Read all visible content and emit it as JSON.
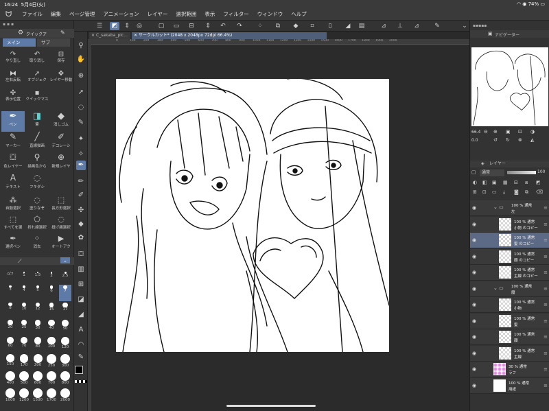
{
  "status": {
    "time": "16:24",
    "date": "5月4日(火)",
    "battery": "74%"
  },
  "menu": {
    "items": [
      "ファイル",
      "編集",
      "ページ管理",
      "アニメーション",
      "レイヤー",
      "選択範囲",
      "表示",
      "フィルター",
      "ウィンドウ",
      "ヘルプ"
    ]
  },
  "tabs": {
    "file1": "C_sakaba_pic...",
    "file2": "サークルカット* (2048 x 2048px 72dpi 66.4%)"
  },
  "ruler": [
    "0",
    "100",
    "200",
    "300",
    "400",
    "500",
    "600",
    "700",
    "800",
    "900",
    "1000",
    "1100",
    "1200",
    "1300",
    "1400",
    "1500",
    "1600",
    "1700",
    "1800",
    "1900",
    "2000"
  ],
  "tool_panel": {
    "header": "クイックア",
    "tab_main": "メイン",
    "tab_sub": "サブ",
    "tools": [
      "やり直し",
      "取り消し",
      "保存",
      "左右反転",
      "オブジェク",
      "レイヤー移動",
      "表示位置",
      "クイックマス",
      "ペン",
      "筆",
      "消しゴム",
      "マーカー",
      "直線描画",
      "デコレーシ",
      "色レイヤー",
      "描画色から",
      "新規レイヤ",
      "テキスト",
      "フキダシ",
      "自動選択",
      "塗りなぞ",
      "長方形選択",
      "すべてを選",
      "折れ線選択",
      "投げ縄選択",
      "選択ペン",
      "消去",
      "オートアク"
    ]
  },
  "brush_sizes": [
    "0.7",
    "1",
    "1.5",
    "2",
    "2.5",
    "3",
    "4",
    "5",
    "6",
    "7",
    "8",
    "10",
    "12",
    "15",
    "17",
    "20",
    "25",
    "30",
    "40",
    "50",
    "60",
    "70",
    "80",
    "100",
    "120",
    "150",
    "170",
    "200",
    "250",
    "300",
    "400",
    "500",
    "600",
    "700",
    "800",
    "1000",
    "1200",
    "1500",
    "1700",
    "2000"
  ],
  "brush_selected": "7",
  "navigator": {
    "title": "ナビゲーター"
  },
  "zoom_value": "66.4",
  "rotation_value": "0.0",
  "layer_panel": {
    "title": "レイヤー",
    "blend_mode": "通常",
    "opacity": "100",
    "layers": [
      {
        "line1": "100 % 通常",
        "line2": "左",
        "type": "folder",
        "selected": false
      },
      {
        "line1": "100 % 通常",
        "line2": "小物 のコピー",
        "type": "layer",
        "selected": false
      },
      {
        "line1": "100 % 通常",
        "line2": "髪 のコピー",
        "type": "layer",
        "selected": true
      },
      {
        "line1": "100 % 通常",
        "line2": "顔 のコピー",
        "type": "layer",
        "selected": false
      },
      {
        "line1": "100 % 通常",
        "line2": "主線 のコピー",
        "type": "layer",
        "selected": false
      },
      {
        "line1": "100 % 通常",
        "line2": "魔",
        "type": "folder",
        "selected": false
      },
      {
        "line1": "100 % 通常",
        "line2": "小物",
        "type": "layer",
        "selected": false
      },
      {
        "line1": "100 % 通常",
        "line2": "髪",
        "type": "layer",
        "selected": false
      },
      {
        "line1": "100 % 通常",
        "line2": "顔",
        "type": "layer",
        "selected": false
      },
      {
        "line1": "100 % 通常",
        "line2": "主線",
        "type": "layer",
        "selected": false
      },
      {
        "line1": "30 % 通常",
        "line2": "ラフ",
        "type": "layer",
        "selected": false
      },
      {
        "line1": "100 % 通常",
        "line2": "用紙",
        "type": "paper",
        "selected": false
      }
    ]
  },
  "colors": {
    "accent": "#5d7ba6",
    "panel": "#333333",
    "canvas": "#2b2b2b"
  }
}
